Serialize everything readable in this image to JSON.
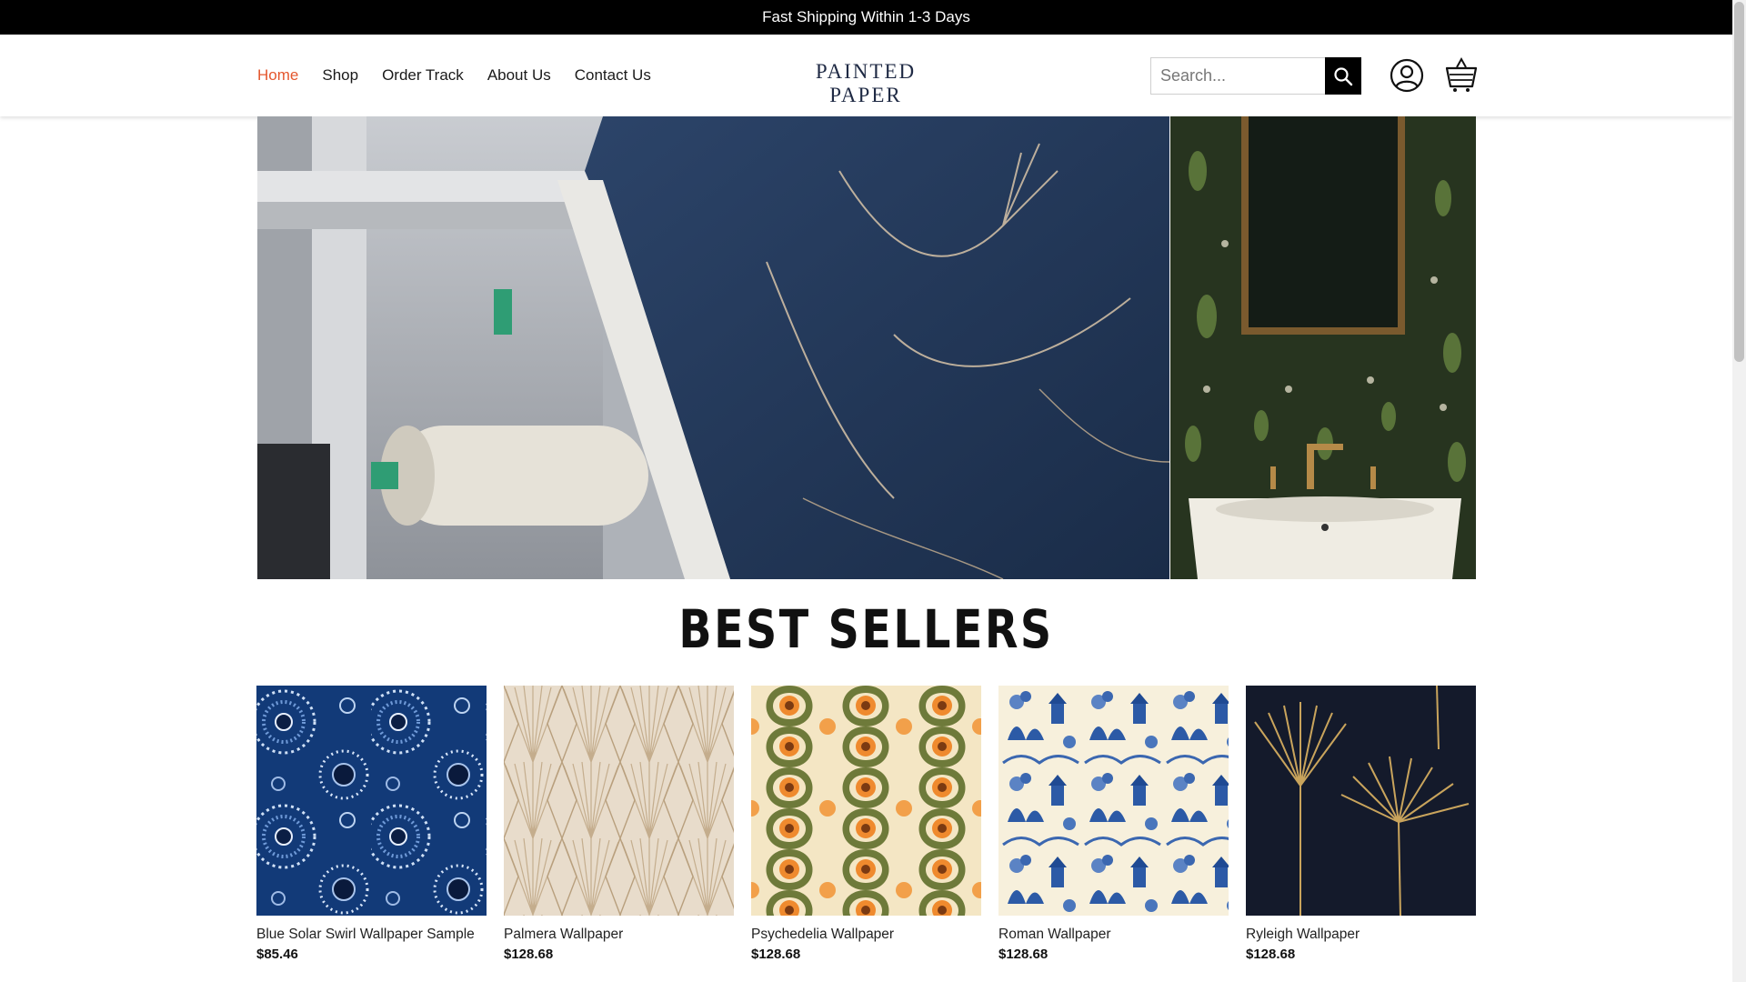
{
  "announcement": "Fast Shipping Within 1-3 Days",
  "nav": {
    "items": [
      {
        "label": "Home",
        "active": true
      },
      {
        "label": "Shop",
        "active": false
      },
      {
        "label": "Order Track",
        "active": false
      },
      {
        "label": "About Us",
        "active": false
      },
      {
        "label": "Contact Us",
        "active": false
      }
    ],
    "active_color": "#e4572e"
  },
  "logo": "PAINTED PAPER",
  "search": {
    "placeholder": "Search...",
    "value": ""
  },
  "icons": {
    "search": "search-icon",
    "account": "user-circle-icon",
    "cart": "shopping-basket-icon"
  },
  "section_title": "BEST SELLERS",
  "products": [
    {
      "name": "Blue Solar Swirl Wallpaper Sample",
      "price": "$85.46"
    },
    {
      "name": "Palmera Wallpaper",
      "price": "$128.68"
    },
    {
      "name": "Psychedelia Wallpaper",
      "price": "$128.68"
    },
    {
      "name": "Roman Wallpaper",
      "price": "$128.68"
    },
    {
      "name": "Ryleigh Wallpaper",
      "price": "$128.68"
    }
  ]
}
